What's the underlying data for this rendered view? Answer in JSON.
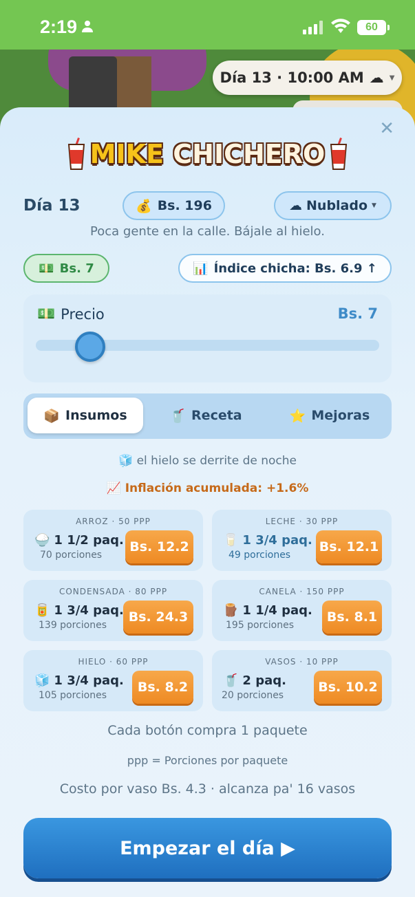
{
  "status_bar": {
    "time": "2:19",
    "battery": "60"
  },
  "hud": {
    "day_time": "Día 13 · 10:00 AM",
    "weather_icon": "cloud"
  },
  "header": {
    "title_part1": "MIKE",
    "title_part2": "CHICHERO"
  },
  "summary": {
    "day": "Día 13",
    "money": "Bs. 196",
    "weather": "Nublado",
    "hint": "Poca gente en la calle. Bájale al hielo.",
    "price_badge": "Bs. 7",
    "index": "Índice chicha: Bs. 6.9 ↑"
  },
  "price": {
    "label": "Precio",
    "value": "Bs. 7",
    "slider_fraction": 0.12
  },
  "tabs": [
    {
      "label": "Insumos",
      "icon": "package",
      "active": true
    },
    {
      "label": "Receta",
      "icon": "cup",
      "active": false
    },
    {
      "label": "Mejoras",
      "icon": "star",
      "active": false
    }
  ],
  "notes": {
    "ice": "el hielo se derrite de noche",
    "inflation": "Inflación acumulada: +1.6%"
  },
  "supplies": [
    {
      "head": "ARROZ · 50 PPP",
      "qty": "1 1/2 paq.",
      "portions": "70 porciones",
      "price": "Bs. 12.2",
      "icon": "rice",
      "highlight": false
    },
    {
      "head": "LECHE · 30 PPP",
      "qty": "1 3/4 paq.",
      "portions": "49 porciones",
      "price": "Bs. 12.1",
      "icon": "milk",
      "highlight": true
    },
    {
      "head": "CONDENSADA · 80 PPP",
      "qty": "1 3/4 paq.",
      "portions": "139 porciones",
      "price": "Bs. 24.3",
      "icon": "can",
      "highlight": false
    },
    {
      "head": "CANELA · 150 PPP",
      "qty": "1 1/4 paq.",
      "portions": "195 porciones",
      "price": "Bs. 8.1",
      "icon": "cinnamon",
      "highlight": false
    },
    {
      "head": "HIELO · 60 PPP",
      "qty": "1 3/4 paq.",
      "portions": "105 porciones",
      "price": "Bs. 8.2",
      "icon": "ice",
      "highlight": false
    },
    {
      "head": "VASOS · 10 PPP",
      "qty": "2 paq.",
      "portions": "20 porciones",
      "price": "Bs. 10.2",
      "icon": "cup",
      "highlight": false
    }
  ],
  "footer": {
    "line1": "Cada botón compra 1 paquete",
    "line2": "ppp = Porciones por paquete",
    "line3": "Costo por vaso Bs. 4.3 · alcanza pa' 16 vasos",
    "start": "Empezar el día ▶"
  }
}
